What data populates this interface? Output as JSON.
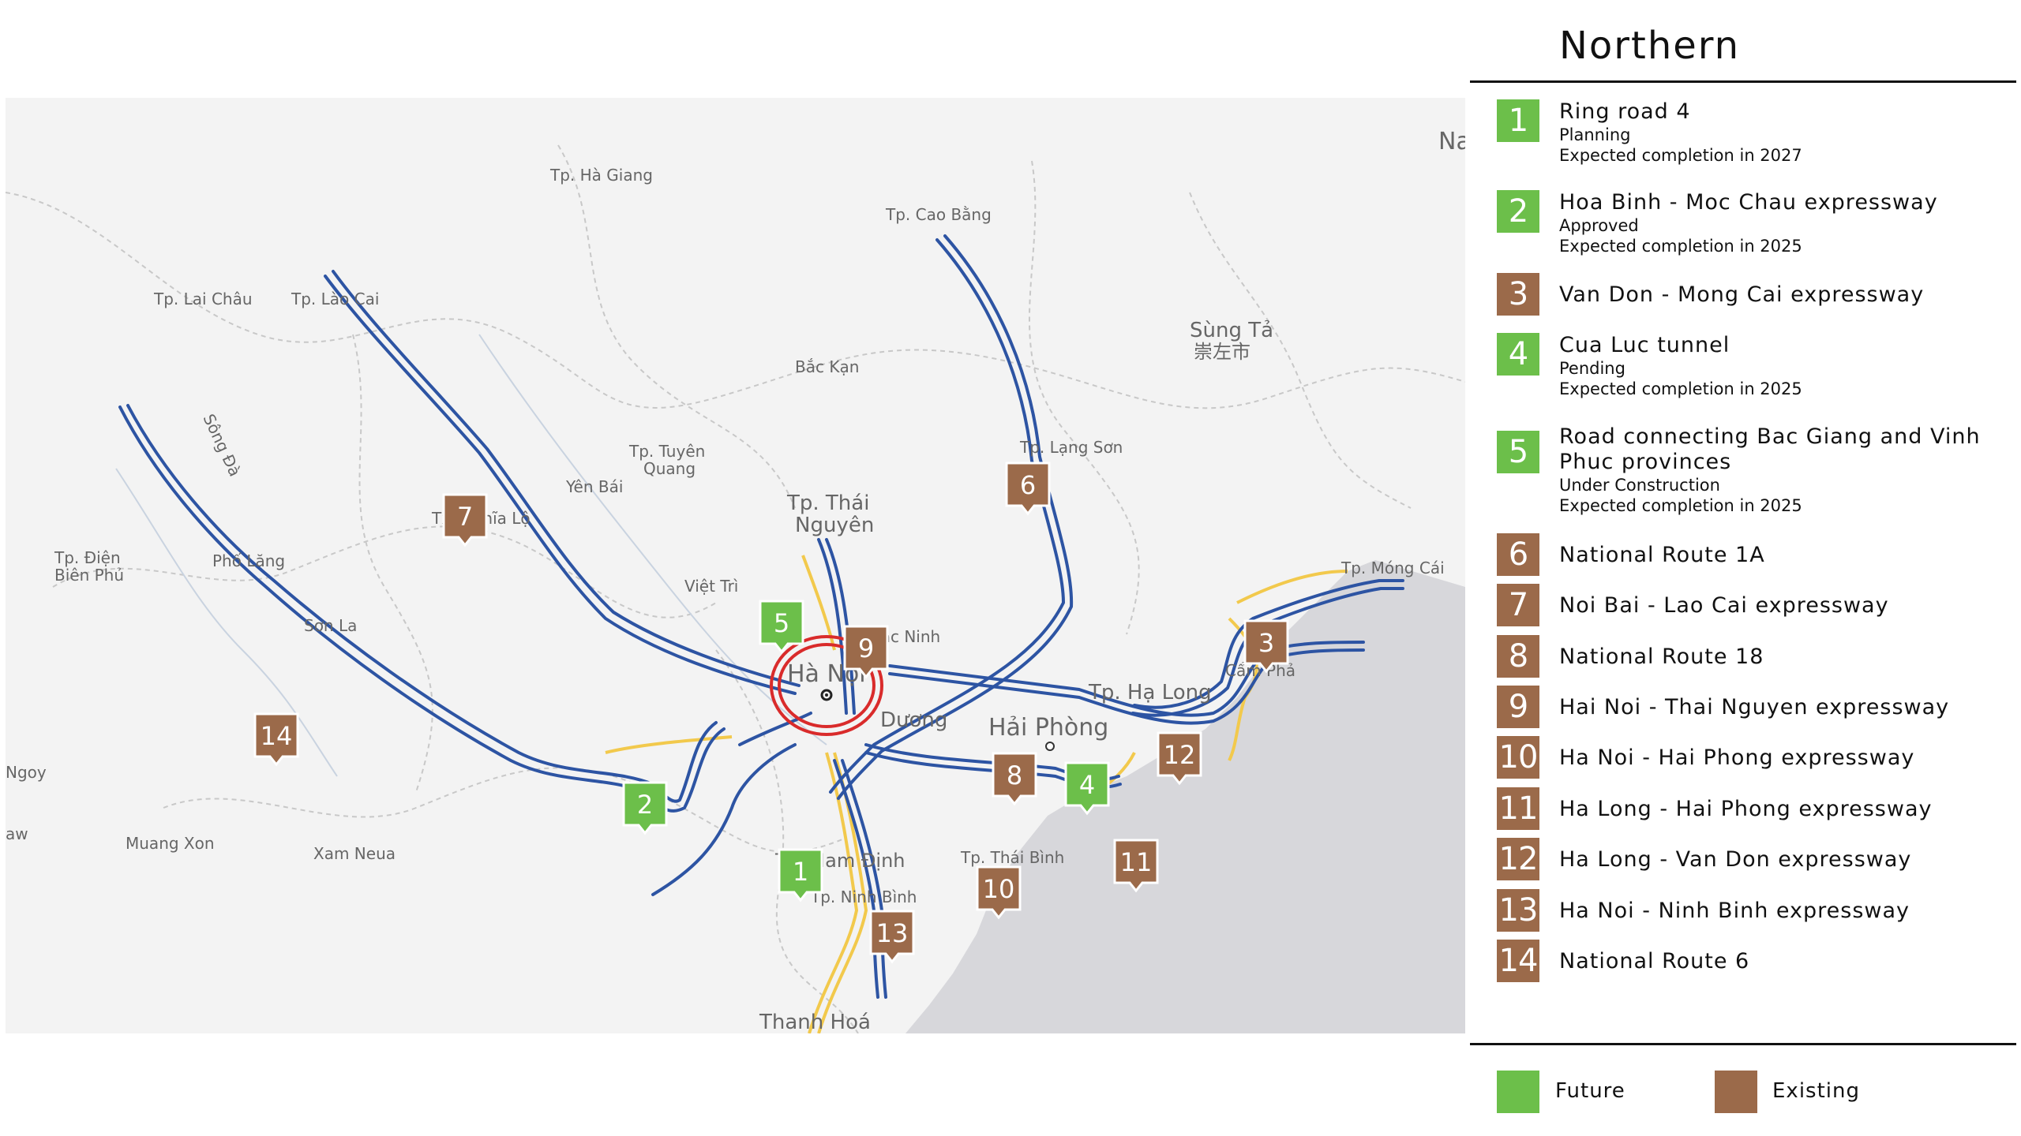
{
  "region_title": "Northern",
  "routes": [
    {
      "num": "1",
      "name": "Ring road 4",
      "sub": [
        "Planning",
        "Expected completion in 2027"
      ],
      "status": "Future"
    },
    {
      "num": "2",
      "name": "Hoa Binh - Moc Chau expressway",
      "sub": [
        "Approved",
        "Expected completion in 2025"
      ],
      "status": "Future"
    },
    {
      "num": "3",
      "name": "Van Don - Mong Cai expressway",
      "sub": [],
      "status": "Existing"
    },
    {
      "num": "4",
      "name": "Cua Luc tunnel",
      "sub": [
        "Pending",
        "Expected completion in 2025"
      ],
      "status": "Future"
    },
    {
      "num": "5",
      "name": "Road connecting Bac Giang and Vinh Phuc provinces",
      "sub": [
        "Under Construction",
        "Expected completion in 2025"
      ],
      "status": "Future"
    },
    {
      "num": "6",
      "name": "National Route 1A",
      "sub": [],
      "status": "Existing"
    },
    {
      "num": "7",
      "name": "Noi Bai - Lao Cai expressway",
      "sub": [],
      "status": "Existing"
    },
    {
      "num": "8",
      "name": "National Route 18",
      "sub": [],
      "status": "Existing"
    },
    {
      "num": "9",
      "name": "Hai Noi - Thai Nguyen expressway",
      "sub": [],
      "status": "Existing"
    },
    {
      "num": "10",
      "name": "Ha Noi - Hai Phong expressway",
      "sub": [],
      "status": "Existing"
    },
    {
      "num": "11",
      "name": "Ha Long - Hai Phong expressway",
      "sub": [],
      "status": "Existing"
    },
    {
      "num": "12",
      "name": "Ha Long - Van Don expressway",
      "sub": [],
      "status": "Existing"
    },
    {
      "num": "13",
      "name": "Ha Noi - Ninh Binh expressway",
      "sub": [],
      "status": "Existing"
    },
    {
      "num": "14",
      "name": "National Route 6",
      "sub": [],
      "status": "Existing"
    }
  ],
  "legend": {
    "future": "Future",
    "existing": "Existing"
  },
  "colors": {
    "future": "#6cbf4a",
    "existing": "#9b6a4a",
    "route": "#2d54a3",
    "ring": "#d92b2b",
    "secondary": "#f2c94c",
    "sea": "#d6d6da",
    "land": "#f3f3f3"
  },
  "map_labels": {
    "ha_giang": "Tp. Hà Giang",
    "cao_bang": "Tp. Cao Bằng",
    "lai_chau": "Tp. Lai Châu",
    "lao_cai": "Tp. Lào Cai",
    "bac_kan": "Bắc Kạn",
    "sung_ta": "Sùng Tả",
    "sung_ta_cn": "崇左市",
    "tuyen_quang_1": "Tp. Tuyên",
    "tuyen_quang_2": "Quang",
    "yen_bai": "Yên Bái",
    "lang_son": "Tp. Lạng Sơn",
    "nghia_lo": "Tx. Nghĩa Lộ",
    "song_da": "Sông Đà",
    "thai_nguyen_1": "Tp. Thái",
    "thai_nguyen_2": "Nguyên",
    "dien_bien_1": "Tp. Điện",
    "dien_bien_2": "Biên Phủ",
    "pho_lang": "Phố Lăng",
    "viet_tri": "Việt Trì",
    "mong_cai": "Tp. Móng Cái",
    "bac_ninh": "Bắc Ninh",
    "son_la": "Sơn La",
    "ha_noi": "Hà Nội",
    "cam_pha": "Cẩm Phả",
    "ha_long": "Tp. Hạ Long",
    "duong": "Dương",
    "hai_phong": "Hải Phòng",
    "ngoy": "Ngoy",
    "muang_xon": "Muang Xon",
    "xam_neua": "Xam Neua",
    "nam_dinh": "Tp. Nam Định",
    "thai_binh": "Tp. Thái Bình",
    "ninh_binh": "Tp. Ninh Bình",
    "thanh_hoa": "Thanh Hoá",
    "na": "Na",
    "aw": "aw"
  }
}
